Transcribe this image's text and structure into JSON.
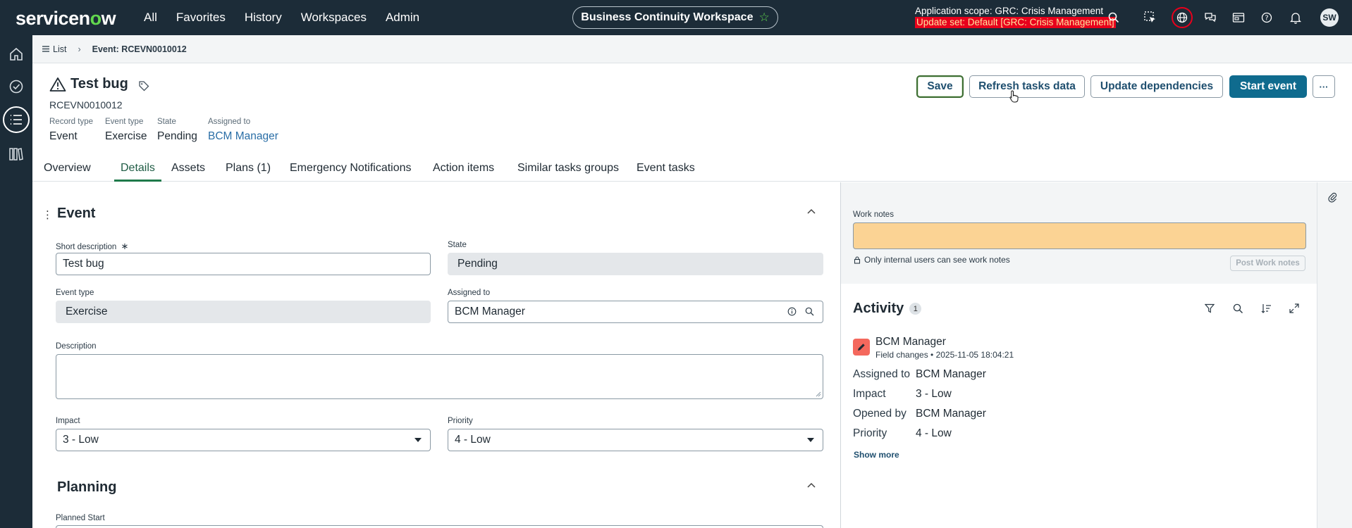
{
  "topnav": {
    "logo": "servicenow",
    "links": [
      "All",
      "Favorites",
      "History",
      "Workspaces",
      "Admin"
    ],
    "workspace": "Business Continuity Workspace",
    "scope_line": "Application scope: GRC: Crisis Management",
    "update_set": "Update set: Default [GRC: Crisis Management]",
    "user_initials": "SW"
  },
  "breadcrumb": {
    "list_label": "List",
    "current": "Event: RCEVN0010012"
  },
  "header": {
    "title": "Test bug",
    "number": "RCEVN0010012",
    "meta": [
      {
        "label": "Record type",
        "value": "Event"
      },
      {
        "label": "Event type",
        "value": "Exercise"
      },
      {
        "label": "State",
        "value": "Pending"
      },
      {
        "label": "Assigned to",
        "value": "BCM Manager"
      }
    ]
  },
  "actions": {
    "save": "Save",
    "refresh": "Refresh tasks data",
    "update_deps": "Update dependencies",
    "start": "Start event",
    "more": "···"
  },
  "tabs": [
    "Overview",
    "Details",
    "Assets",
    "Plans (1)",
    "Emergency Notifications",
    "Action items",
    "Similar tasks groups",
    "Event tasks"
  ],
  "form": {
    "section_event": "Event",
    "short_description_label": "Short description",
    "required_mark": "∗",
    "short_description_value": "Test bug",
    "state_label": "State",
    "state_value": "Pending",
    "event_type_label": "Event type",
    "event_type_value": "Exercise",
    "assigned_to_label": "Assigned to",
    "assigned_to_value": "BCM Manager",
    "description_label": "Description",
    "impact_label": "Impact",
    "impact_value": "3 - Low",
    "priority_label": "Priority",
    "priority_value": "4 - Low",
    "section_planning": "Planning",
    "planned_start_label": "Planned Start"
  },
  "work_notes": {
    "label": "Work notes",
    "note": "Only internal users can see work notes",
    "post": "Post Work notes"
  },
  "activity": {
    "title": "Activity",
    "count": "1",
    "entry": {
      "name": "BCM Manager",
      "sub": "Field changes • 2025-11-05 18:04:21",
      "changes": [
        {
          "label": "Assigned to",
          "value": "BCM Manager"
        },
        {
          "label": "Impact",
          "value": "3 - Low"
        },
        {
          "label": "Opened by",
          "value": "BCM Manager"
        },
        {
          "label": "Priority",
          "value": "4 - Low"
        }
      ]
    },
    "show_more": "Show more"
  }
}
